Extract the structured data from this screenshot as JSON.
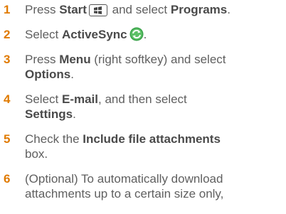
{
  "steps": [
    {
      "num": "1",
      "parts": [
        "Press ",
        "Start",
        " and select ",
        "Programs",
        "."
      ]
    },
    {
      "num": "2",
      "parts": [
        "Select ",
        "ActiveSync",
        "."
      ]
    },
    {
      "num": "3",
      "line1": [
        "Press ",
        "Menu",
        " (right softkey) and select"
      ],
      "line2": [
        "Options",
        "."
      ]
    },
    {
      "num": "4",
      "line1": [
        "Select ",
        "E-mail",
        ", and then select"
      ],
      "line2": [
        "Settings",
        "."
      ]
    },
    {
      "num": "5",
      "line1": [
        "Check the ",
        "Include file attachments"
      ],
      "line2": [
        "box."
      ]
    },
    {
      "num": "6",
      "line1": [
        "(Optional) To automatically download"
      ],
      "line2": [
        "attachments up to a certain size only,"
      ]
    }
  ],
  "icons": {
    "start_key": "windows-start-key-icon",
    "activesync": "activesync-icon"
  },
  "colors": {
    "step_number": "#e07a00",
    "text": "#5f5f5f",
    "activesync_green": "#3aa24a"
  }
}
